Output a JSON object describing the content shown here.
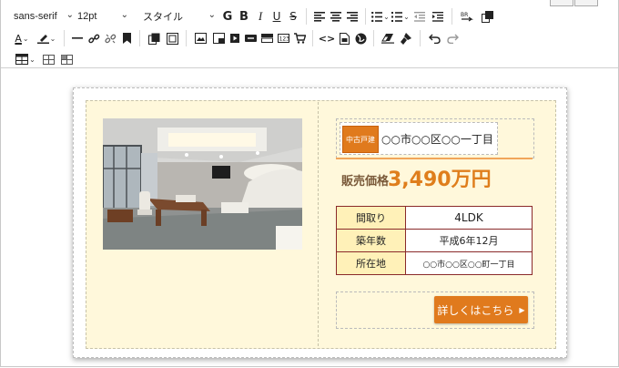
{
  "toolbar": {
    "font_family": "sans-serif",
    "font_size": "12pt",
    "style_label": "スタイル",
    "bold_label": "G",
    "italic_label": "I",
    "underline_label": "U",
    "strike_label": "S",
    "text_color_label": "A",
    "code_label": "<>"
  },
  "listing": {
    "badge": "中古戸建",
    "address": "○○市○○区○○一丁目",
    "price_label": "販売価格",
    "price_value": "3,490万円",
    "details": [
      {
        "key": "間取り",
        "value": "4LDK"
      },
      {
        "key": "築年数",
        "value": "平成6年12月"
      },
      {
        "key": "所在地",
        "value": "○○市○○区○○町一丁目"
      }
    ],
    "cta_label": "詳しくはこちら",
    "accent_color": "#e07a1d",
    "panel_color": "#fff8db"
  }
}
